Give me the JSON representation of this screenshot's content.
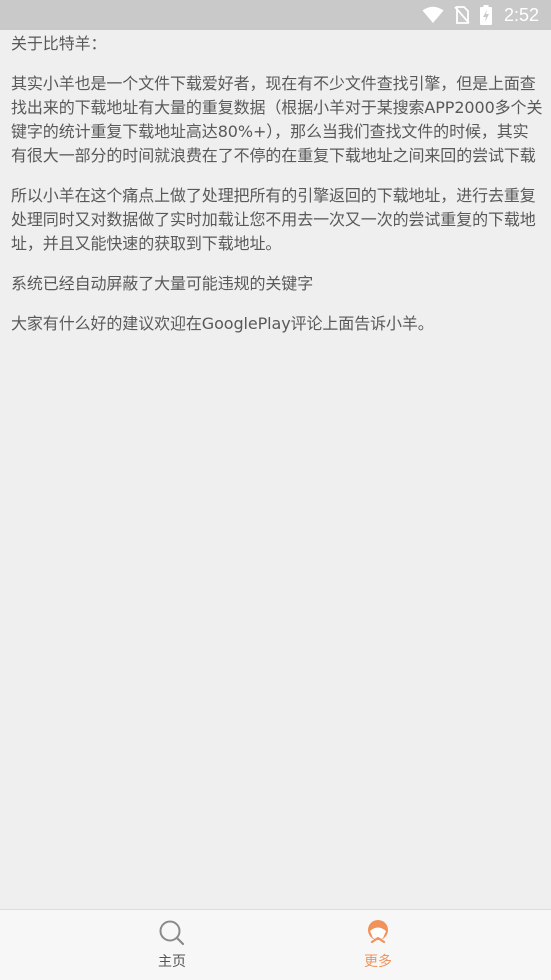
{
  "status_bar": {
    "time": "2:52",
    "icons": [
      "wifi-icon",
      "no-sim-icon",
      "battery-charging-icon"
    ]
  },
  "content": {
    "paragraphs": [
      "关于比特羊：",
      "其实小羊也是一个文件下载爱好者，现在有不少文件查找引擎，但是上面查找出来的下载地址有大量的重复数据（根据小羊对于某搜索APP2000多个关键字的统计重复下载地址高达80%+），那么当我们查找文件的时候，其实有很大一部分的时间就浪费在了不停的在重复下载地址之间来回的尝试下载",
      "所以小羊在这个痛点上做了处理把所有的引擎返回的下载地址，进行去重复处理同时又对数据做了实时加载让您不用去一次又一次的尝试重复的下载地址，并且又能快速的获取到下载地址。",
      "系统已经自动屏蔽了大量可能违规的关键字",
      "大家有什么好的建议欢迎在GooglePlay评论上面告诉小羊。"
    ]
  },
  "bottom_nav": {
    "items": [
      {
        "label": "主页",
        "icon": "search-icon",
        "active": false
      },
      {
        "label": "更多",
        "icon": "more-icon",
        "active": true
      }
    ],
    "colors": {
      "active": "#f0935a",
      "inactive": "#8a8a8a"
    }
  }
}
